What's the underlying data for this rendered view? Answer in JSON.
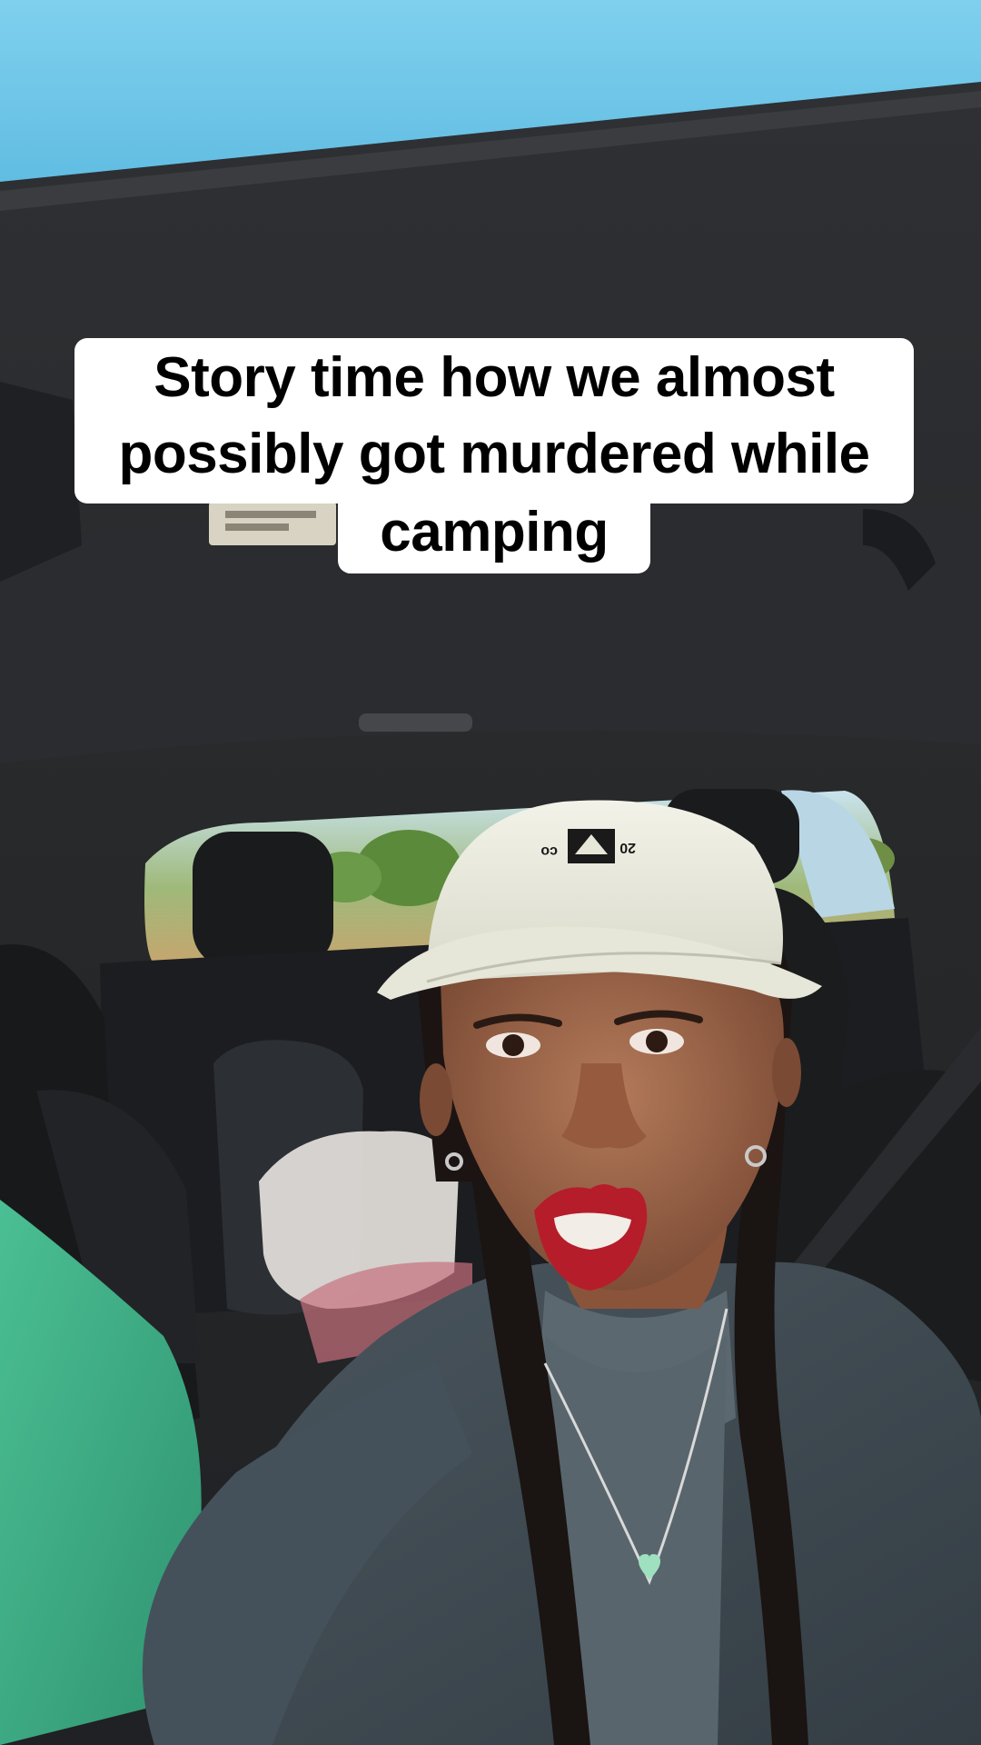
{
  "caption": {
    "lines": [
      "Story time how we almost",
      "possibly got murdered while",
      "camping"
    ]
  },
  "scene": {
    "cap_logo_left": "co",
    "cap_logo_right": "20",
    "sky_color": "#6cc6e6",
    "headliner_color": "#2a2c30",
    "sweatshirt_color": "#3d4850",
    "passenger_fleece_color": "#3fae86",
    "cap_color": "#ececdf",
    "lip_color": "#b51d2b"
  }
}
